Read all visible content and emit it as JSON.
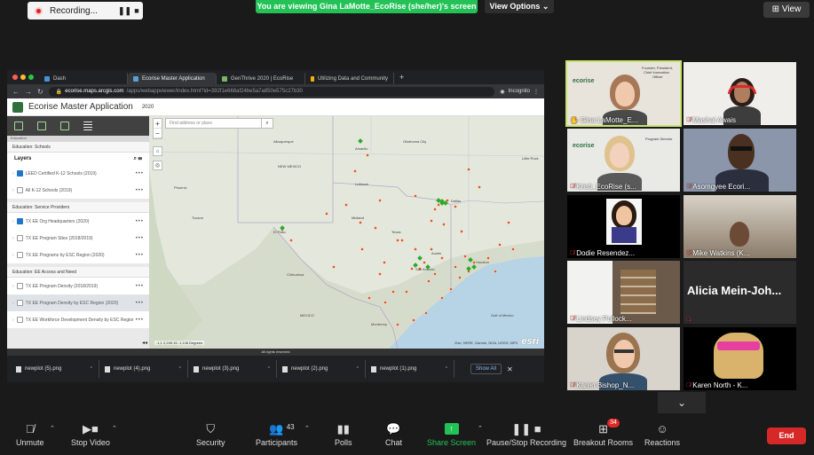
{
  "recording": {
    "label": "Recording...",
    "pause_icon": "❚❚",
    "stop_icon": "■"
  },
  "share_banner": "You are viewing Gina LaMotte_EcoRise (she/her)'s screen",
  "view_options": "View Options ⌄",
  "view_button": "View",
  "browser": {
    "tabs": [
      "Dash",
      "Ecorise Master Application",
      "GenThrive 2020 | EcoRise",
      "Utilizing Data and Community"
    ],
    "url_host": "ecorise.maps.arcgis.com",
    "url_rest": "/apps/webappviewer/index.html?id=392f1e668af24be5a7a850e575c27b30",
    "incognito": "Incognito"
  },
  "app": {
    "title": "Ecorise Master Application",
    "year": "2020",
    "strip": "Education"
  },
  "sidebar": {
    "sections": [
      {
        "title": "Education: Schools",
        "layers_label": "Layers",
        "rows": [
          {
            "label": "LEED Certified K-12 Schools (2019)",
            "checked": true
          },
          {
            "label": "All K-12 Schools (2019)",
            "checked": false
          }
        ]
      },
      {
        "title": "Education: Service Providers",
        "rows": [
          {
            "label": "TX EE Org Headquarters (2020)",
            "checked": true
          },
          {
            "label": "TX EE Program Sites (2018/2019)",
            "checked": false
          },
          {
            "label": "TX EE Programs by ESC Region (2020)",
            "checked": false
          }
        ]
      },
      {
        "title": "Education: EE Access and Need",
        "rows": [
          {
            "label": "TX EE Program Density (2018/2019)",
            "checked": false
          },
          {
            "label": "TX EE Program Density by ESC Region (2020)",
            "checked": false
          },
          {
            "label": "TX EE Workforce Development Density by ESC Region (2020)",
            "checked": false
          }
        ]
      }
    ]
  },
  "map": {
    "search_placeholder": "Find address or place",
    "labels": {
      "albuquerque": "Albuquerque",
      "amarillo": "Amarillo",
      "oklahoma_city": "Oklahoma City",
      "little_rock": "Little Rock",
      "lubbock": "Lubbock",
      "phoenix": "Phoenix",
      "dallas": "Dallas",
      "midland": "Midland",
      "austin": "Austin",
      "houston": "Houston",
      "san_antonio": "San Antonio",
      "el_paso": "El Paso",
      "texas": "Texas",
      "mexico": "MEXICO",
      "gulf": "Gulf of Mexico",
      "monterrey": "Monterrey",
      "chihuahua": "Chihuahua",
      "new_mexico": "NEW MEXICO",
      "tucson": "Tucson"
    },
    "coords": "-104.6 21.06 Degrees",
    "coords_full": "-1,1 2,249.15 -1,128 Degrees",
    "attribution": "Esri, HERE, Garmin, NGA, USGS, NPS",
    "esri": "esri",
    "footer": "All rights reserved"
  },
  "downloads": {
    "items": [
      "newplot (5).png",
      "newplot (4).png",
      "newplot (3).png",
      "newplot (2).png",
      "newplot (1).png"
    ],
    "show_all": "Show All"
  },
  "participants": [
    {
      "name": "Gina LaMotte_E...",
      "muted": false
    },
    {
      "name": "Mashal Awais",
      "muted": true
    },
    {
      "name": "Kristi_EcoRise (s...",
      "muted": true
    },
    {
      "name": "Asomgyee Ecori...",
      "muted": true
    },
    {
      "name": "Dodie Resendez...",
      "muted": true
    },
    {
      "name": "Mike Watkins (K...",
      "muted": true
    },
    {
      "name": "Lindsey Pollock...",
      "muted": true
    },
    {
      "name": "Alicia  Mein-Joh...",
      "muted": true
    },
    {
      "name": "Karen Bishop_N...",
      "muted": true
    },
    {
      "name": "Karen North - K...",
      "muted": true
    }
  ],
  "tile_overlay": {
    "org": "ecorise",
    "title1": "Founder, President,",
    "title2": "Chief Innovation",
    "title3": "Officer",
    "kristi_title": "Program Director"
  },
  "toolbar": {
    "unmute": "Unmute",
    "stop_video": "Stop Video",
    "security": "Security",
    "participants": "Participants",
    "participants_count": "43",
    "polls": "Polls",
    "chat": "Chat",
    "share_screen": "Share Screen",
    "record": "Pause/Stop Recording",
    "breakout": "Breakout Rooms",
    "breakout_badge": "34",
    "reactions": "Reactions",
    "end": "End"
  }
}
